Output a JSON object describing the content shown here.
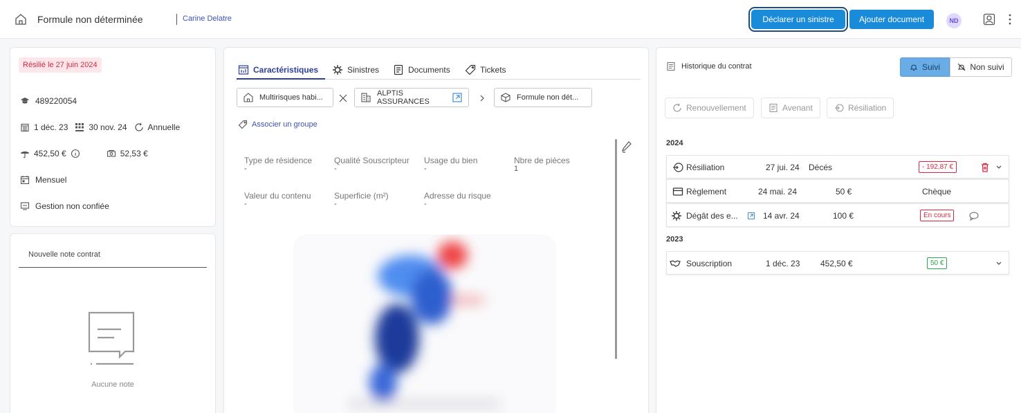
{
  "header": {
    "contract_title": "Formule non déterminée",
    "person_name": "Carine Delatre",
    "declare_label": "Déclarer un sinistre",
    "add_document_label": "Ajouter document",
    "avatar_initials": "ND",
    "icons": [
      "home-icon",
      "user-icon",
      "kebab-menu-icon"
    ]
  },
  "summary": {
    "status": "Résilié le 27 juin 2024",
    "contract_number": "489220054",
    "start_date": "1 déc. 23",
    "end_date": "30 nov. 24",
    "renewal": "Annuelle",
    "premium": "452,50 €",
    "fees": "52,53 €",
    "payment_frequency": "Mensuel",
    "management": "Gestion non confiée"
  },
  "notes": {
    "placeholder": "Nouvelle note contrat",
    "empty_text": "Aucune note"
  },
  "tabs": [
    {
      "label": "Caractéristiques",
      "active": true
    },
    {
      "label": "Sinistres",
      "active": false
    },
    {
      "label": "Documents",
      "active": false
    },
    {
      "label": "Tickets",
      "active": false
    }
  ],
  "chips": {
    "product": "Multirisques habi...",
    "insurer": "ALPTIS ASSURANCES",
    "formula": "Formule non dét..."
  },
  "associate_group": "Associer un groupe",
  "fields": [
    {
      "label": "Type de résidence",
      "value": "-"
    },
    {
      "label": "Qualité Souscripteur",
      "value": "-"
    },
    {
      "label": "Usage du bien",
      "value": "-"
    },
    {
      "label": "Nbre de pièces",
      "value": "1"
    },
    {
      "label": "Valeur du contenu",
      "value": "-"
    },
    {
      "label": "Superficie (m²)",
      "value": "-"
    },
    {
      "label": "Adresse du risque",
      "value": "-"
    }
  ],
  "history": {
    "title": "Historique du contrat",
    "follow_label": "Suivi",
    "unfollow_label": "Non suivi",
    "actions": [
      "Renouvellement",
      "Avenant",
      "Résiliation"
    ],
    "years": [
      {
        "year": "2024",
        "rows": [
          {
            "type": "Résiliation",
            "date": "27 jui. 24",
            "detail": "Décés",
            "badge": "- 192,87 €"
          },
          {
            "type": "Règlement",
            "date": "24 mai. 24",
            "amount": "50 €",
            "method": "Chèque"
          },
          {
            "type": "Dégât des e...",
            "date": "14 avr. 24",
            "amount": "100 €",
            "badge": "En cours"
          }
        ]
      },
      {
        "year": "2023",
        "rows": [
          {
            "type": "Souscription",
            "date": "1 déc. 23",
            "amount": "452,50 €",
            "badge": "50 €"
          }
        ]
      }
    ]
  },
  "colors": {
    "primary_button": "#1a8bd9",
    "accent_text": "#3f51b5",
    "danger": "#d6273f",
    "success": "#2aa84a",
    "follow_active": "#6aace6"
  }
}
